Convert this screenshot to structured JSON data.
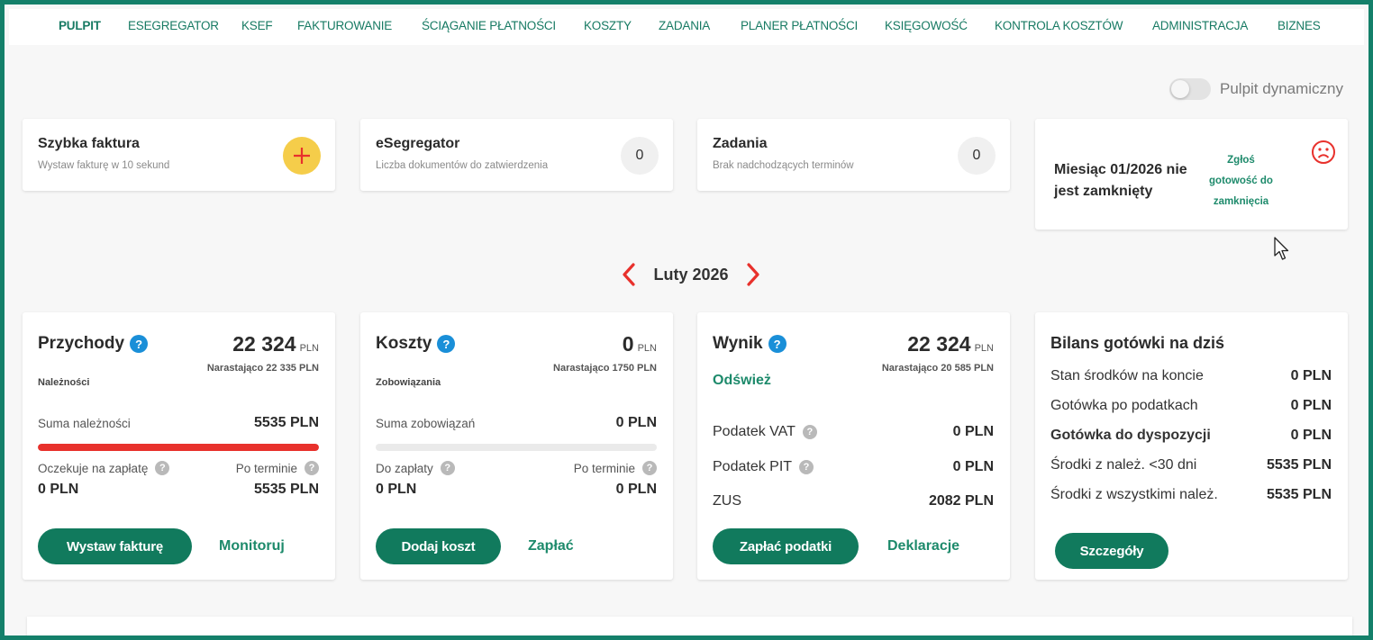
{
  "nav": {
    "items": [
      {
        "label": "PULPIT"
      },
      {
        "label": "ESEGREGATOR"
      },
      {
        "label": "KSEF"
      },
      {
        "label": "FAKTUROWANIE"
      },
      {
        "label": "ŚCIĄGANIE PŁATNOŚCI"
      },
      {
        "label": "KOSZTY"
      },
      {
        "label": "ZADANIA"
      },
      {
        "label": "PLANER PŁATNOŚCI"
      },
      {
        "label": "KSIĘGOWOŚĆ"
      },
      {
        "label": "KONTROLA KOSZTÓW"
      },
      {
        "label": "ADMINISTRACJA"
      },
      {
        "label": "BIZNES"
      }
    ],
    "active": "PULPIT"
  },
  "toggle": {
    "label": "Pulpit dynamiczny",
    "on": false
  },
  "quick_invoice": {
    "title": "Szybka faktura",
    "subtitle": "Wystaw fakturę w 10 sekund"
  },
  "esegregator": {
    "title": "eSegregator",
    "subtitle": "Liczba dokumentów do zatwierdzenia",
    "count": "0"
  },
  "tasks": {
    "title": "Zadania",
    "subtitle": "Brak nadchodzących terminów",
    "count": "0"
  },
  "month_status": {
    "message": "Miesiąc 01/2026 nie jest zamknięty",
    "link": "Zgłoś gotowość do zamknięcia"
  },
  "period": {
    "label": "Luty 2026"
  },
  "revenue": {
    "title": "Przychody",
    "help": "?",
    "amount": "22 324",
    "unit": "PLN",
    "cumulative": "Narastająco 22 335 PLN",
    "section": "Należności",
    "sum_label": "Suma należności",
    "sum_value": "5535 PLN",
    "progress": 1.0,
    "awaiting_label": "Oczekuje na zapłatę",
    "awaiting_value": "0 PLN",
    "overdue_label": "Po terminie",
    "overdue_value": "5535 PLN",
    "button": "Wystaw fakturę",
    "link": "Monitoruj"
  },
  "costs": {
    "title": "Koszty",
    "help": "?",
    "amount": "0",
    "unit": "PLN",
    "cumulative": "Narastająco 1750 PLN",
    "section": "Zobowiązania",
    "sum_label": "Suma zobowiązań",
    "sum_value": "0 PLN",
    "progress": 0.0,
    "topay_label": "Do zapłaty",
    "topay_value": "0 PLN",
    "overdue_label": "Po terminie",
    "overdue_value": "0 PLN",
    "button": "Dodaj koszt",
    "link": "Zapłać"
  },
  "result": {
    "title": "Wynik",
    "help": "?",
    "amount": "22 324",
    "unit": "PLN",
    "cumulative": "Narastająco 20 585 PLN",
    "refresh": "Odśwież",
    "rows": [
      {
        "label": "Podatek VAT",
        "value": "0 PLN"
      },
      {
        "label": "Podatek PIT",
        "value": "0 PLN"
      },
      {
        "label": "ZUS",
        "value": "2082 PLN"
      }
    ],
    "button": "Zapłać podatki",
    "link": "Deklaracje"
  },
  "cash": {
    "title": "Bilans gotówki na dziś",
    "rows": [
      {
        "label": "Stan środków na koncie",
        "value": "0 PLN"
      },
      {
        "label": "Gotówka po podatkach",
        "value": "0 PLN"
      },
      {
        "label": "Gotówka do dyspozycji",
        "value": "0 PLN"
      },
      {
        "label": "Środki z należ. <30 dni",
        "value": "5535 PLN"
      },
      {
        "label": "Środki z wszystkimi należ.",
        "value": "5535 PLN"
      }
    ],
    "button": "Szczegóły"
  },
  "colors": {
    "brand": "#117a5d",
    "nav_text": "#177a63",
    "alert_red": "#e8312c",
    "help_blue": "#1a8fd8",
    "plus_yellow": "#f5cd4a"
  },
  "icons": {
    "plus": "plus-icon",
    "sad": "sad-face-icon",
    "help": "help-icon",
    "chevron_left": "chevron-left-icon",
    "chevron_right": "chevron-right-icon",
    "cursor": "mouse-cursor-icon"
  }
}
